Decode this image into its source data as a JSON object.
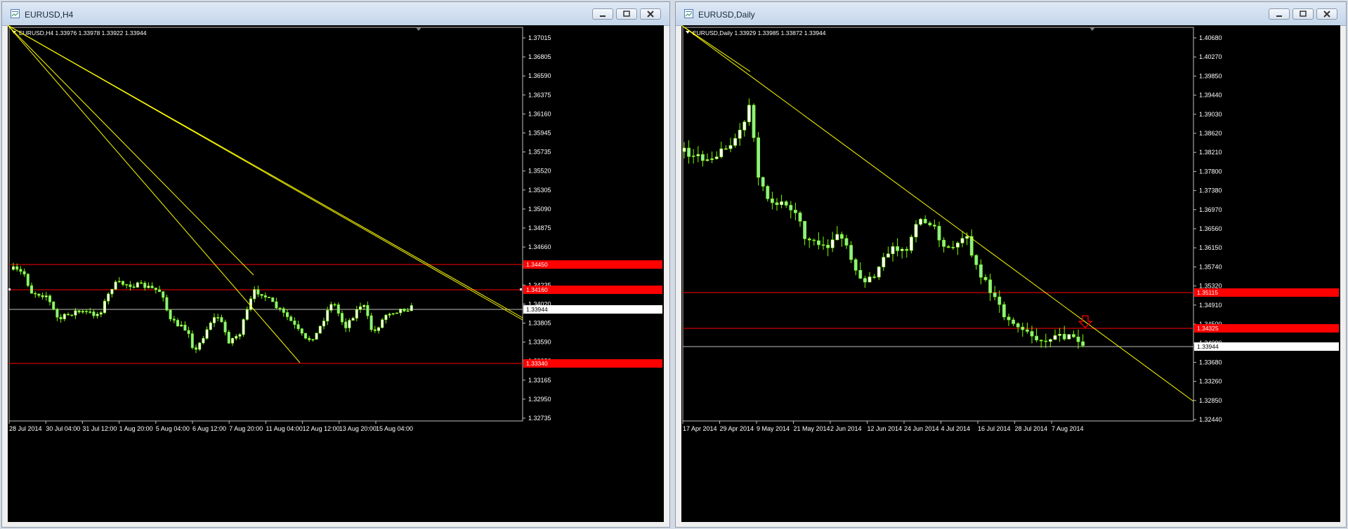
{
  "windows": [
    {
      "title": "EURUSD,H4",
      "info": "EURUSD,H4  1.33976 1.33978 1.33922 1.33944",
      "yticks": [
        "1.37015",
        "1.36805",
        "1.36590",
        "1.36375",
        "1.36160",
        "1.35945",
        "1.35735",
        "1.35520",
        "1.35305",
        "1.35090",
        "1.34875",
        "1.34660",
        "1.34445",
        "1.34235",
        "1.34020",
        "1.33805",
        "1.33590",
        "1.33380",
        "1.33165",
        "1.32950",
        "1.32735"
      ],
      "xticks": [
        "28 Jul 2014",
        "30 Jul 04:00",
        "31 Jul 12:00",
        "1 Aug 20:00",
        "5 Aug 04:00",
        "6 Aug 12:00",
        "7 Aug 20:00",
        "11 Aug 04:00",
        "12 Aug 12:00",
        "13 Aug 20:00",
        "15 Aug 04:00"
      ],
      "levels": [
        {
          "label": "1.34450",
          "color": "#ff0000"
        },
        {
          "label": "1.34160",
          "color": "#ff0000"
        },
        {
          "label": "1.33944",
          "color": "#c0c0c0"
        },
        {
          "label": "1.33340",
          "color": "#ff0000"
        }
      ]
    },
    {
      "title": "EURUSD,Daily",
      "info": "EURUSD,Daily  1.33929 1.33985 1.33872 1.33944",
      "yticks": [
        "1.40680",
        "1.40270",
        "1.39850",
        "1.39440",
        "1.39030",
        "1.38620",
        "1.38210",
        "1.37800",
        "1.37380",
        "1.36970",
        "1.36560",
        "1.36150",
        "1.35740",
        "1.35320",
        "1.34910",
        "1.34500",
        "1.34090",
        "1.33680",
        "1.33260",
        "1.32850",
        "1.32440"
      ],
      "xticks": [
        "17 Apr 2014",
        "29 Apr 2014",
        "9 May 2014",
        "21 May 2014",
        "2 Jun 2014",
        "12 Jun 2014",
        "24 Jun 2014",
        "4 Jul 2014",
        "16 Jul 2014",
        "28 Jul 2014",
        "7 Aug 2014"
      ],
      "levels": [
        {
          "label": "1.35115",
          "color": "#ff0000"
        },
        {
          "label": "1.34325",
          "color": "#ff0000"
        },
        {
          "label": "1.33944",
          "color": "#c0c0c0"
        }
      ]
    }
  ],
  "colors": {
    "candle_up": "#ffffff",
    "candle_down": "#90ee90",
    "wick": "#7cfc00",
    "trendline": "#ffff00",
    "level": "#ff0000",
    "bid": "#c0c0c0",
    "axis_text": "#ffffff",
    "chart_bg": "#000000",
    "arrow": "#ff0000"
  }
}
